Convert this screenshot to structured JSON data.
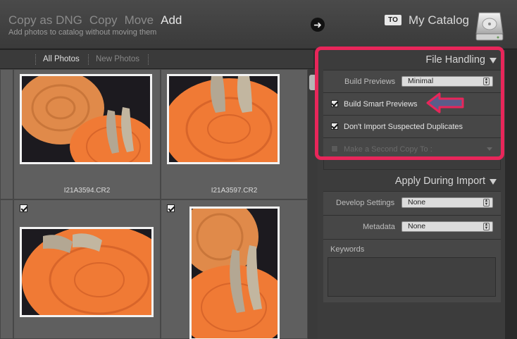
{
  "top": {
    "mode_tabs": [
      "Copy as DNG",
      "Copy",
      "Move",
      "Add"
    ],
    "active_mode": "Add",
    "subtitle": "Add photos to catalog without moving them",
    "to_badge": "TO",
    "catalog_name": "My Catalog"
  },
  "grid_toolbar": {
    "all_photos": "All Photos",
    "new_photos": "New Photos"
  },
  "grid": {
    "items": [
      {
        "filename": "I21A3594.CR2",
        "checked": false
      },
      {
        "filename": "I21A3597.CR2",
        "checked": false
      },
      {
        "filename": "",
        "checked": true
      },
      {
        "filename": "",
        "checked": true
      }
    ]
  },
  "file_handling": {
    "title": "File Handling",
    "build_previews_label": "Build Previews",
    "build_previews_value": "Minimal",
    "smart_previews_label": "Build Smart Previews",
    "smart_previews_checked": true,
    "duplicates_label": "Don't Import Suspected Duplicates",
    "duplicates_checked": true,
    "second_copy_label": "Make a Second Copy To :",
    "second_copy_checked": false
  },
  "apply_during_import": {
    "title": "Apply During Import",
    "develop_label": "Develop Settings",
    "develop_value": "None",
    "metadata_label": "Metadata",
    "metadata_value": "None",
    "keywords_label": "Keywords"
  },
  "colors": {
    "highlight": "#e8265a",
    "arrow_fill": "#5a5d8a",
    "wood": "#e87a3a"
  }
}
